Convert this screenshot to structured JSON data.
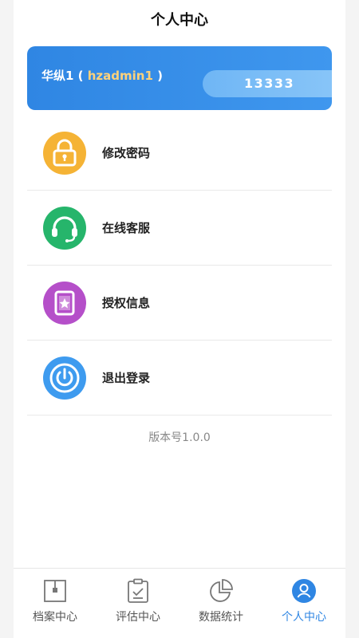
{
  "header": {
    "title": "个人中心"
  },
  "profile": {
    "name_prefix": "华纵1 ( ",
    "account": "hzadmin1",
    "name_suffix": " )",
    "badge_value": "13333"
  },
  "menu": {
    "items": [
      {
        "label": "修改密码",
        "icon": "lock-icon",
        "color": "#f5b335"
      },
      {
        "label": "在线客服",
        "icon": "headset-icon",
        "color": "#26b56b"
      },
      {
        "label": "授权信息",
        "icon": "certificate-icon",
        "color": "#b54fc9"
      },
      {
        "label": "退出登录",
        "icon": "power-icon",
        "color": "#3e9bef"
      }
    ]
  },
  "version_text": "版本号1.0.0",
  "tabbar": {
    "items": [
      {
        "label": "档案中心",
        "icon": "archive-icon"
      },
      {
        "label": "评估中心",
        "icon": "clipboard-check-icon"
      },
      {
        "label": "数据统计",
        "icon": "pie-chart-icon"
      },
      {
        "label": "个人中心",
        "icon": "user-icon",
        "active": true
      }
    ]
  },
  "colors": {
    "accent": "#2f86e3",
    "inactive_tab": "#555555"
  }
}
